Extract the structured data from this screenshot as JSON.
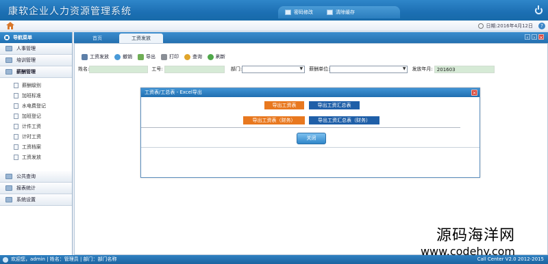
{
  "header": {
    "app_title": "康软企业人力资源管理系统",
    "btn_password": "密码修改",
    "btn_clear": "清除缓存"
  },
  "subbar": {
    "date": "日期:2016年4月12日"
  },
  "sidebar": {
    "title": "导航菜单",
    "menu": [
      {
        "label": "人事管理"
      },
      {
        "label": "培训管理"
      },
      {
        "label": "薪酬管理"
      }
    ],
    "sub_items": [
      {
        "label": "薪酬级别"
      },
      {
        "label": "加班标准"
      },
      {
        "label": "水电费登记"
      },
      {
        "label": "加班登记"
      },
      {
        "label": "计件工资"
      },
      {
        "label": "计时工资"
      },
      {
        "label": "工资档案"
      },
      {
        "label": "工资发放"
      }
    ],
    "menu_bottom": [
      {
        "label": "公共查询"
      },
      {
        "label": "报表统计"
      },
      {
        "label": "系统设置"
      }
    ]
  },
  "tabs": [
    {
      "label": "首页"
    },
    {
      "label": "工资发放"
    }
  ],
  "toolbar": {
    "issue": "工资发放",
    "revoke": "撤销",
    "export": "导出",
    "print": "打印",
    "query": "查询",
    "refresh": "刷新"
  },
  "search": {
    "name_label": "姓名:",
    "id_label": "工号:",
    "dept_label": "部门:",
    "unit_label": "薪酬单位:",
    "month_label": "发放年月:",
    "month_value": "201603"
  },
  "dialog": {
    "title": "工资表/工总表 - Excel导出",
    "btn_export_salary": "导出工资表",
    "btn_export_summary": "导出工资汇总表",
    "btn_export_salary_fin": "导出工资表（财务）",
    "btn_export_summary_fin": "导出工资汇总表（财务）",
    "btn_close": "关闭"
  },
  "statusbar": {
    "left": "欢迎您，admin  |  姓名：管理员  |  部门：部门名称",
    "right": "Call Center V2.0  2012-2015"
  },
  "watermark": {
    "line1": "源码海洋网",
    "line2": "www.codehy.com"
  },
  "colors": {
    "header_blue": "#1c6fb3",
    "orange_btn": "#e8781f",
    "blue_btn": "#1f5fa8"
  }
}
